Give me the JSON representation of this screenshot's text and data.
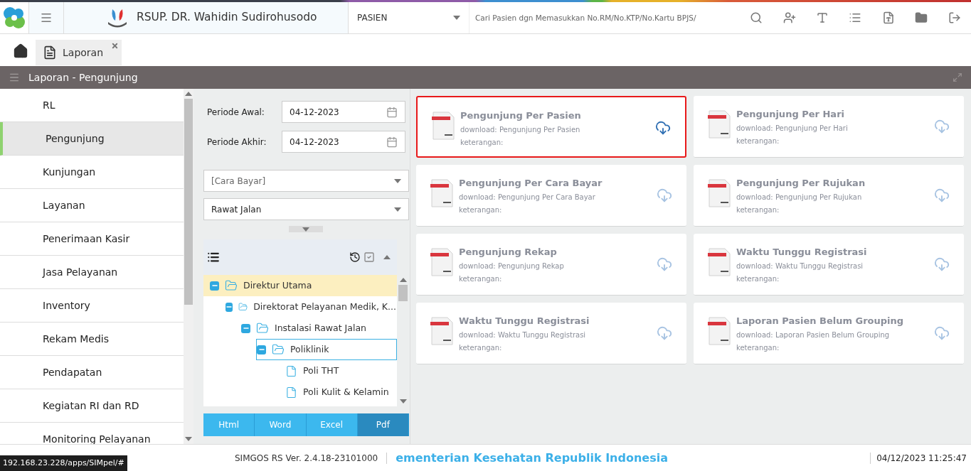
{
  "header": {
    "hospital": "RSUP. DR. Wahidin Sudirohusodo",
    "search_type": "PASIEN",
    "search": {
      "placeholder": "Cari Pasien dgn Memasukkan No.RM/No.KTP/No.Kartu BPJS/"
    }
  },
  "tabs": [
    {
      "label": "Laporan",
      "selected": true
    }
  ],
  "panel_title": "Laporan - Pengunjung",
  "sidebar": {
    "items": [
      {
        "label": "RL",
        "selected": false
      },
      {
        "label": "Pengunjung",
        "selected": true
      },
      {
        "label": "Kunjungan",
        "selected": false
      },
      {
        "label": "Layanan",
        "selected": false
      },
      {
        "label": "Penerimaan Kasir",
        "selected": false
      },
      {
        "label": "Jasa Pelayanan",
        "selected": false
      },
      {
        "label": "Inventory",
        "selected": false
      },
      {
        "label": "Rekam Medis",
        "selected": false
      },
      {
        "label": "Pendapatan",
        "selected": false
      },
      {
        "label": "Kegiatan RI dan RD",
        "selected": false
      },
      {
        "label": "Monitoring Pelayanan",
        "selected": false
      }
    ]
  },
  "filters": {
    "dates": [
      {
        "label": "Periode Awal:",
        "value": "04-12-2023"
      },
      {
        "label": "Periode Akhir:",
        "value": "04-12-2023"
      }
    ],
    "selects": [
      {
        "value": "[Cara Bayar]",
        "kind": "placeholder"
      },
      {
        "value": "Rawat Jalan",
        "kind": "value"
      }
    ]
  },
  "tree": [
    {
      "label": "Direktur Utama",
      "kind": "folder",
      "selected": true,
      "focused": false,
      "children": [
        {
          "label": "Direktorat Pelayanan Medik, K...",
          "kind": "folder",
          "selected": false,
          "focused": false,
          "children": [
            {
              "label": "Instalasi Rawat Jalan",
              "kind": "folder",
              "selected": false,
              "focused": false,
              "children": [
                {
                  "label": "Poliklinik",
                  "kind": "folder",
                  "selected": false,
                  "focused": true,
                  "children": [
                    {
                      "label": "Poli THT",
                      "kind": "file",
                      "selected": false,
                      "focused": false
                    },
                    {
                      "label": "Poli Kulit & Kelamin",
                      "kind": "file",
                      "selected": false,
                      "focused": false
                    }
                  ]
                }
              ]
            }
          ]
        }
      ]
    }
  ],
  "formats": [
    {
      "label": "Html",
      "selected": false
    },
    {
      "label": "Word",
      "selected": false
    },
    {
      "label": "Excel",
      "selected": false
    },
    {
      "label": "Pdf",
      "selected": true
    }
  ],
  "reports": [
    {
      "title": "Pengunjung Per Pasien",
      "download": "download: Pengunjung Per Pasien",
      "note": "keterangan:",
      "selected": true
    },
    {
      "title": "Pengunjung Per Hari",
      "download": "download: Pengunjung Per Hari",
      "note": "keterangan:",
      "selected": false
    },
    {
      "title": "Pengunjung Per Cara Bayar",
      "download": "download: Pengunjung Per Cara Bayar",
      "note": "keterangan:",
      "selected": false
    },
    {
      "title": "Pengunjung Per Rujukan",
      "download": "download: Pengunjung Per Rujukan",
      "note": "keterangan:",
      "selected": false
    },
    {
      "title": "Pengunjung Rekap",
      "download": "download: Pengunjung Rekap",
      "note": "keterangan:",
      "selected": false
    },
    {
      "title": "Waktu Tunggu Registrasi",
      "download": "download: Waktu Tunggu Registrasi",
      "note": "keterangan:",
      "selected": false
    },
    {
      "title": "Waktu Tunggu Registrasi",
      "download": "download: Waktu Tunggu Registrasi",
      "note": "keterangan:",
      "selected": false
    },
    {
      "title": "Laporan Pasien Belum Grouping",
      "download": "download: Laporan Pasien Belum Grouping",
      "note": "keterangan:",
      "selected": false
    }
  ],
  "footer": {
    "version": "SIMGOS RS Ver. 2.4.18-23101000",
    "ticker": "ementerian Kesehatan Republik Indonesia",
    "datetime": "04/12/2023 11:25:47"
  },
  "status_url": "192.168.23.228/apps/SIMpel/#"
}
